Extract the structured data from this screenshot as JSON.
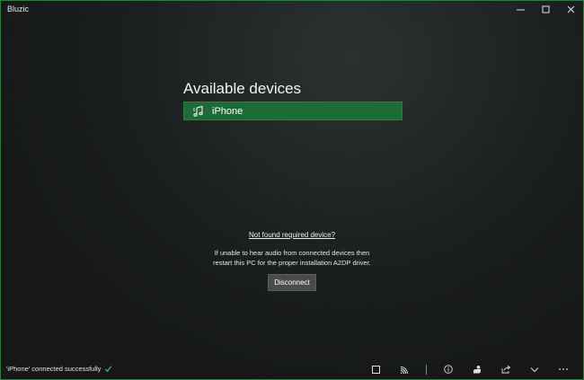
{
  "window": {
    "title": "Bluzic"
  },
  "devices": {
    "heading": "Available devices",
    "items": [
      {
        "label": "iPhone",
        "icon": "music-device-icon"
      }
    ]
  },
  "help": {
    "link": "Not found required device?",
    "line1": "If unable to hear audio from connected devices then",
    "line2": "restart this PC for the proper installation A2DP driver.",
    "disconnect_label": "Disconnect"
  },
  "status": {
    "message": "'iPhone' connected successfully"
  },
  "colors": {
    "accent": "#1e6b35",
    "border": "#2f7a3f",
    "check": "#3fbf5f"
  }
}
